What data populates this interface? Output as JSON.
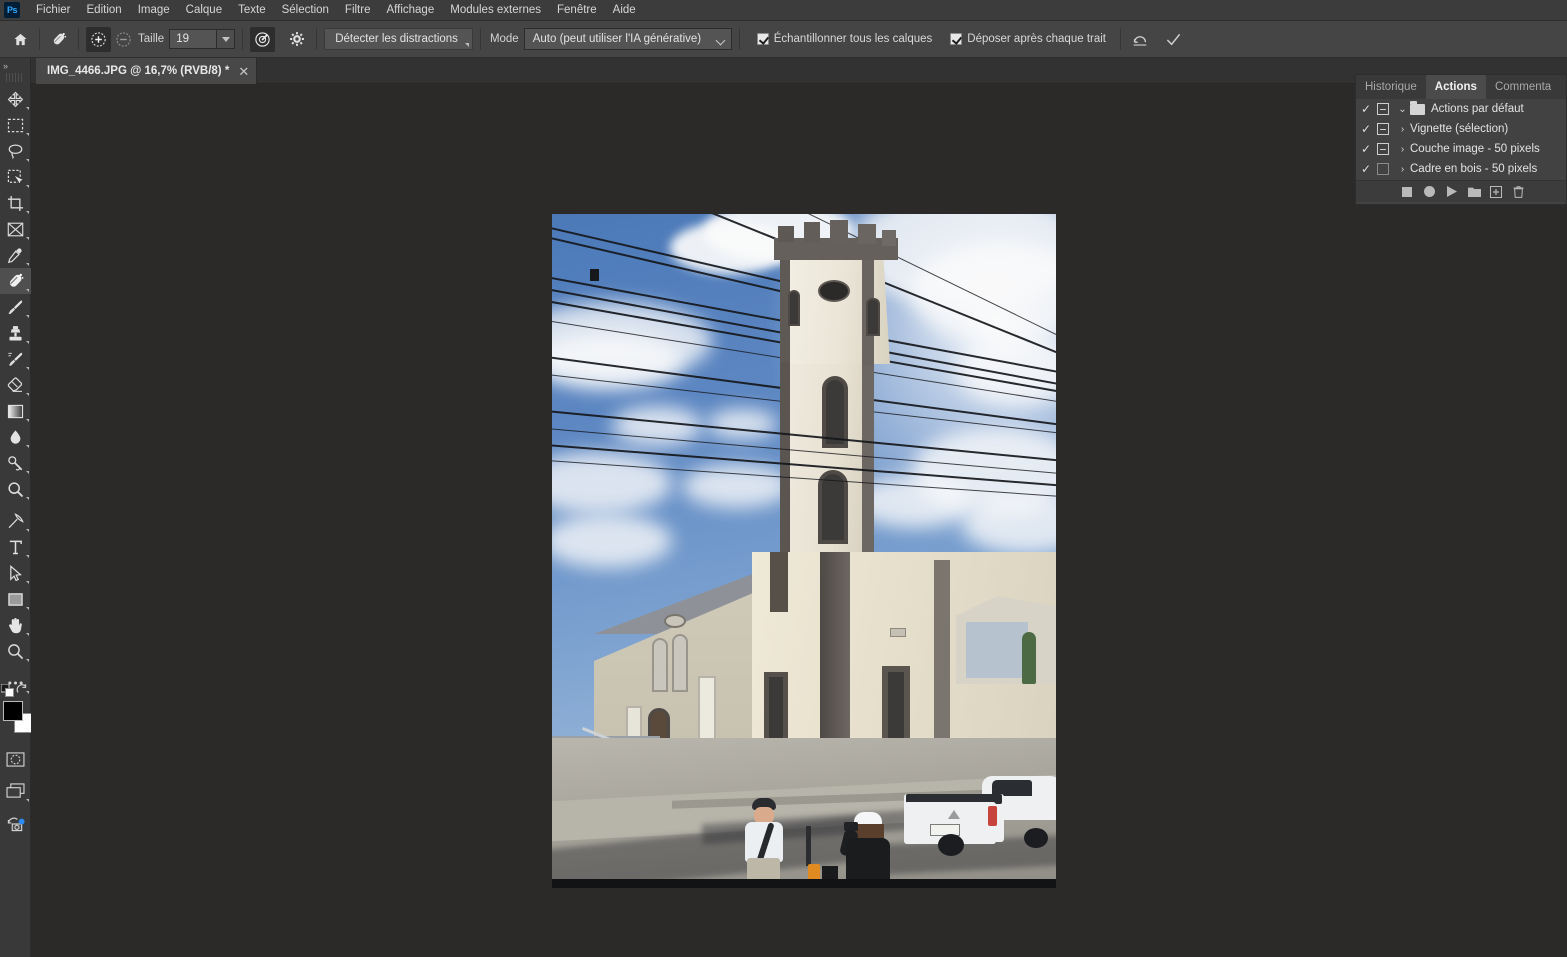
{
  "app": {
    "name": "Adobe Photoshop",
    "logo_text": "Ps"
  },
  "menubar": {
    "items": [
      {
        "label": "Fichier"
      },
      {
        "label": "Edition"
      },
      {
        "label": "Image"
      },
      {
        "label": "Calque"
      },
      {
        "label": "Texte"
      },
      {
        "label": "Sélection"
      },
      {
        "label": "Filtre"
      },
      {
        "label": "Affichage"
      },
      {
        "label": "Modules externes"
      },
      {
        "label": "Fenêtre"
      },
      {
        "label": "Aide"
      }
    ]
  },
  "options_bar": {
    "home_icon": "home-icon",
    "tool_icon": "spot-healing-brush-icon",
    "brush_add_icon": "brush-size-increase-icon",
    "brush_remove_icon": "brush-size-decrease-icon",
    "size_label": "Taille",
    "size_value": "19",
    "brush_settings_icon": "brush-settings-icon",
    "gear_icon": "gear-icon",
    "detect_distractions_label": "Détecter les distractions",
    "mode_label": "Mode",
    "mode_value": "Auto (peut utiliser l'IA générative)",
    "sample_all_layers_label": "Échantillonner tous les calques",
    "sample_all_layers_checked": true,
    "drop_after_stroke_label": "Déposer après chaque trait",
    "drop_after_stroke_checked": true,
    "undo_icon": "undo-icon",
    "commit_icon": "checkmark-icon"
  },
  "document_tab": {
    "title": "IMG_4466.JPG @ 16,7% (RVB/8) *",
    "close_glyph": "✕"
  },
  "toolbar": {
    "collapse_glyph": "»",
    "tools": [
      {
        "name": "move-tool",
        "glyph": "move"
      },
      {
        "name": "rectangular-marquee-tool",
        "glyph": "marquee"
      },
      {
        "name": "lasso-tool",
        "glyph": "lasso"
      },
      {
        "name": "object-selection-tool",
        "glyph": "objsel"
      },
      {
        "name": "crop-tool",
        "glyph": "crop"
      },
      {
        "name": "frame-tool",
        "glyph": "frame"
      },
      {
        "name": "eyedropper-tool",
        "glyph": "eyedropper"
      },
      {
        "name": "spot-healing-brush-tool",
        "glyph": "healing",
        "selected": true
      },
      {
        "name": "brush-tool",
        "glyph": "brush"
      },
      {
        "name": "clone-stamp-tool",
        "glyph": "stamp"
      },
      {
        "name": "history-brush-tool",
        "glyph": "historybrush"
      },
      {
        "name": "eraser-tool",
        "glyph": "eraser"
      },
      {
        "name": "gradient-tool",
        "glyph": "gradient"
      },
      {
        "name": "blur-tool",
        "glyph": "blur"
      },
      {
        "name": "dodge-tool",
        "glyph": "dodge"
      },
      {
        "name": "zoom-tool",
        "glyph": "zoom"
      },
      {
        "name": "pen-tool",
        "glyph": "pen"
      },
      {
        "name": "type-tool",
        "glyph": "type"
      },
      {
        "name": "path-selection-tool",
        "glyph": "pathsel"
      },
      {
        "name": "rectangle-tool",
        "glyph": "rectangle"
      },
      {
        "name": "hand-tool",
        "glyph": "hand"
      },
      {
        "name": "magnifier-tool",
        "glyph": "magnifier"
      },
      {
        "name": "edit-toolbar-button",
        "glyph": "ellipsis"
      }
    ],
    "foreground_color": "#000000",
    "background_color": "#ffffff",
    "swap_colors_icon": "swap-colors-icon",
    "default_colors_icon": "default-colors-icon",
    "quick_mask_icon": "quick-mask-icon",
    "screen_mode_icon": "screen-mode-icon",
    "share_icon": "share-icon"
  },
  "actions_panel": {
    "tabs": [
      {
        "label": "Historique",
        "active": false
      },
      {
        "label": "Actions",
        "active": true
      },
      {
        "label": "Commenta",
        "active": false
      }
    ],
    "more_glyph": "»",
    "rows": [
      {
        "label": "Actions par défaut",
        "checked": true,
        "toggle": true,
        "expand": "down",
        "is_set": true
      },
      {
        "label": "Vignette (sélection)",
        "checked": true,
        "toggle": true,
        "expand": "right",
        "is_set": false
      },
      {
        "label": "Couche image - 50 pixels",
        "checked": true,
        "toggle": true,
        "expand": "right",
        "is_set": false
      },
      {
        "label": "Cadre en bois - 50 pixels",
        "checked": true,
        "toggle": false,
        "expand": "right",
        "is_set": false
      }
    ],
    "footer_buttons": [
      {
        "name": "stop-recording-button",
        "glyph": "stop"
      },
      {
        "name": "begin-recording-button",
        "glyph": "record"
      },
      {
        "name": "play-selection-button",
        "glyph": "play"
      },
      {
        "name": "create-new-set-button",
        "glyph": "folder"
      },
      {
        "name": "create-new-action-button",
        "glyph": "plus"
      },
      {
        "name": "delete-button",
        "glyph": "trash"
      }
    ]
  },
  "canvas": {
    "image_name": "IMG_4466.JPG",
    "zoom_level": "16,7%",
    "color_mode": "RVB/8",
    "background_color": "#2b2a29",
    "description": "Photo of a cream-colored church with a stone tower against a blue sky with clouds and overhead power lines; two pedestrians and a white pickup truck on the street below."
  }
}
